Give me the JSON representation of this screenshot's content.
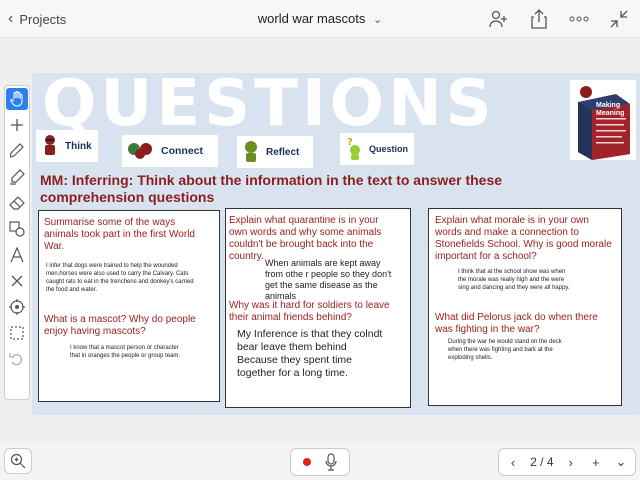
{
  "header": {
    "back_label": "Projects",
    "doc_title": "world war mascots",
    "icons": [
      "add-person-icon",
      "share-icon",
      "more-icon",
      "collapse-icon"
    ]
  },
  "toolbox": {
    "tools": [
      "pointer-icon",
      "plus-icon",
      "pen-icon",
      "highlighter-icon",
      "eraser-icon",
      "shape-icon",
      "text-icon",
      "close-icon",
      "target-icon",
      "select-box-icon",
      "undo-icon"
    ]
  },
  "slide": {
    "title": "QUESTIONS",
    "badges": [
      {
        "label": "Think"
      },
      {
        "label": "Connect"
      },
      {
        "label": "Reflect"
      },
      {
        "label": "Question"
      }
    ],
    "graphic_label": "Making Meaning",
    "heading": "MM: Inferring: Think about the information in the text  to answer these comprehension questions",
    "cards": [
      {
        "q1": "Summarise some of the ways animals took part in the first World War.",
        "a1": "I infer that dogs were trained to help the wounded men,horses were also used to carry the Calvary. Cats caught rats to eat in the trenchens and donkey's carried the food and water.",
        "q2": "What is a mascot? Why do people enjoy having mascots?",
        "a2": "I know that  a mascot person or character that in oranges the people or group team."
      },
      {
        "q1": "Explain what quarantine is in your own words and why some animals couldn't be brought back into the country.",
        "a1": "When animals are kept away from othe r people so they don't get the same disease as the animals",
        "q2": "Why was it hard for soldiers to leave their animal friends behind?",
        "a2": "My Inference is that they colndt bear leave them behind Because they spent time together for a long time."
      },
      {
        "q1": "Explain what morale is in your own words and make a connection to Stonefields School. Why is good morale important for a school?",
        "a1": "I think that at the school show was when the morale was really high and the were sing and dancing and they were all happy.",
        "q2": "What did Pelorus jack do when there was fighting in the war?",
        "a2": "During the war he would stand on the deck when there was fighting and bark at the exploding shells."
      }
    ]
  },
  "footer": {
    "page_indicator": "2 / 4"
  },
  "colors": {
    "accent": "#2d7ff0",
    "slide_bg": "#d9e2ef",
    "question_red": "#9b1d1d",
    "record_red": "#e02424"
  }
}
